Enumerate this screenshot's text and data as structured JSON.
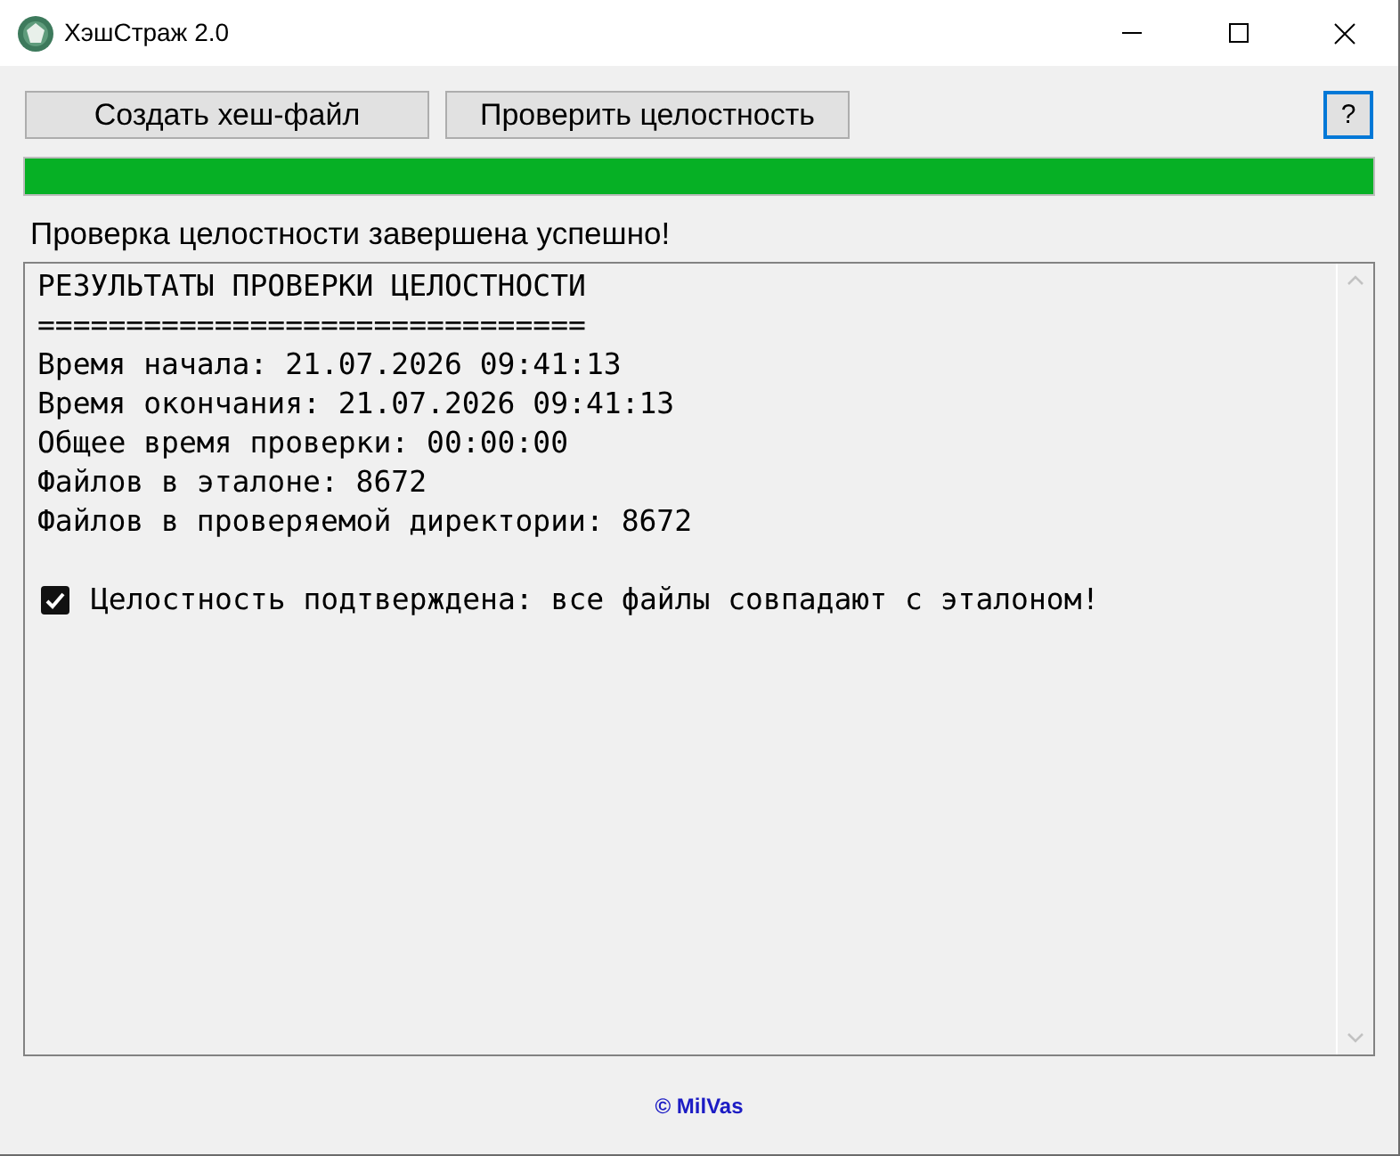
{
  "window": {
    "title": "ХэшСтраж 2.0"
  },
  "toolbar": {
    "buttons": [
      {
        "label": "Создать хеш-файл"
      },
      {
        "label": "Проверить целостность"
      }
    ],
    "help_button": {
      "label": "?"
    }
  },
  "progress": {
    "level": 1
  },
  "status": {
    "text": "Проверка целостности завершена успешно!"
  },
  "results": {
    "lines": [
      {
        "kind": "text",
        "text": "РЕЗУЛЬТАТЫ ПРОВЕРКИ ЦЕЛОСТНОСТИ"
      },
      {
        "kind": "text",
        "text": "==============================="
      },
      {
        "kind": "text",
        "text": "Время начала: 21.07.2026 09:41:13"
      },
      {
        "kind": "text",
        "text": "Время окончания: 21.07.2026 09:41:13"
      },
      {
        "kind": "text",
        "text": "Общее время проверки: 00:00:00"
      },
      {
        "kind": "text",
        "text": "Файлов в эталоне: 8672"
      },
      {
        "kind": "text",
        "text": "Файлов в проверяемой директории: 8672"
      },
      {
        "kind": "blank"
      },
      {
        "kind": "check",
        "checked": true,
        "text": "Целостность подтверждена: все файлы совпадают с эталоном!"
      }
    ]
  },
  "footer": {
    "text": "© MilVas"
  }
}
